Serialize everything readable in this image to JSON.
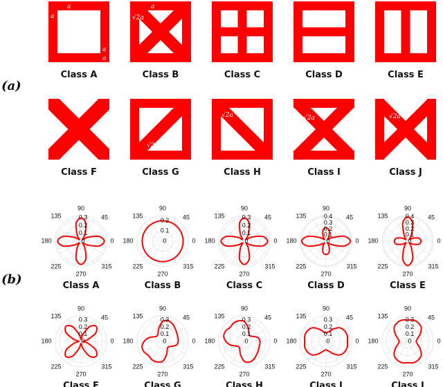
{
  "panel_labels": {
    "a": "(a)",
    "b": "(b)"
  },
  "annotation": {
    "a": "a",
    "root2a": "√2a"
  },
  "colors": {
    "structure": "#ff0000",
    "curve": "#ff0000",
    "grid": "#e0e0e0"
  },
  "classes": [
    "Class A",
    "Class B",
    "Class C",
    "Class D",
    "Class E",
    "Class F",
    "Class G",
    "Class H",
    "Class I",
    "Class J"
  ],
  "chart_data": {
    "type": "polar",
    "angle_ticks": [
      "90",
      "45",
      "0",
      "315",
      "270",
      "225",
      "180",
      "135"
    ],
    "angles_deg": [
      0,
      15,
      30,
      45,
      60,
      75,
      90,
      105,
      120,
      135,
      150,
      165,
      180,
      195,
      210,
      225,
      240,
      255,
      270,
      285,
      300,
      315,
      330,
      345
    ],
    "plots": [
      {
        "class": "Class A",
        "r_ticks": [
          "0",
          "0.1",
          "0.2",
          "0.3"
        ],
        "rmax": 0.33,
        "r": [
          0.3,
          0.24,
          0.1,
          0.03,
          0.1,
          0.24,
          0.3,
          0.24,
          0.1,
          0.03,
          0.1,
          0.24,
          0.3,
          0.24,
          0.1,
          0.03,
          0.1,
          0.24,
          0.3,
          0.24,
          0.1,
          0.03,
          0.1,
          0.24
        ]
      },
      {
        "class": "Class B",
        "r_ticks": [
          "0",
          "0.1",
          "0.2"
        ],
        "rmax": 0.25,
        "r": [
          0.2,
          0.2,
          0.2,
          0.2,
          0.2,
          0.2,
          0.2,
          0.2,
          0.2,
          0.2,
          0.2,
          0.2,
          0.2,
          0.2,
          0.2,
          0.2,
          0.2,
          0.2,
          0.2,
          0.2,
          0.2,
          0.2,
          0.2,
          0.2
        ]
      },
      {
        "class": "Class C",
        "r_ticks": [
          "0",
          "0.1",
          "0.2",
          "0.3"
        ],
        "rmax": 0.33,
        "r": [
          0.3,
          0.24,
          0.1,
          0.03,
          0.1,
          0.24,
          0.3,
          0.24,
          0.1,
          0.03,
          0.1,
          0.24,
          0.3,
          0.24,
          0.1,
          0.03,
          0.1,
          0.24,
          0.3,
          0.24,
          0.1,
          0.03,
          0.1,
          0.24
        ]
      },
      {
        "class": "Class D",
        "r_ticks": [
          "0",
          "0.1",
          "0.2",
          "0.3",
          "0.4"
        ],
        "rmax": 0.42,
        "r": [
          0.4,
          0.31,
          0.12,
          0.04,
          0.1,
          0.19,
          0.22,
          0.19,
          0.1,
          0.04,
          0.12,
          0.31,
          0.4,
          0.31,
          0.12,
          0.04,
          0.1,
          0.19,
          0.22,
          0.19,
          0.1,
          0.04,
          0.12,
          0.31
        ]
      },
      {
        "class": "Class E",
        "r_ticks": [
          "0",
          "0.1",
          "0.2",
          "0.3",
          "0.4"
        ],
        "rmax": 0.42,
        "r": [
          0.22,
          0.19,
          0.1,
          0.04,
          0.12,
          0.31,
          0.4,
          0.31,
          0.12,
          0.04,
          0.1,
          0.19,
          0.22,
          0.19,
          0.1,
          0.04,
          0.12,
          0.31,
          0.4,
          0.31,
          0.12,
          0.04,
          0.1,
          0.19
        ]
      },
      {
        "class": "Class F",
        "r_ticks": [
          "0",
          "0.1",
          "0.2",
          "0.3"
        ],
        "rmax": 0.36,
        "r": [
          0.03,
          0.1,
          0.24,
          0.3,
          0.24,
          0.1,
          0.03,
          0.1,
          0.24,
          0.3,
          0.24,
          0.1,
          0.03,
          0.1,
          0.24,
          0.3,
          0.24,
          0.1,
          0.03,
          0.1,
          0.24,
          0.3,
          0.24,
          0.1
        ]
      },
      {
        "class": "Class G",
        "r_ticks": [
          "0",
          "0.1",
          "0.2",
          "0.3"
        ],
        "rmax": 0.36,
        "r": [
          0.22,
          0.22,
          0.23,
          0.25,
          0.28,
          0.3,
          0.28,
          0.2,
          0.13,
          0.11,
          0.13,
          0.2,
          0.26,
          0.3,
          0.3,
          0.28,
          0.3,
          0.3,
          0.28,
          0.2,
          0.13,
          0.11,
          0.14,
          0.2
        ]
      },
      {
        "class": "Class H",
        "r_ticks": [
          "0",
          "0.1",
          "0.2",
          "0.3"
        ],
        "rmax": 0.36,
        "r": [
          0.22,
          0.2,
          0.14,
          0.11,
          0.13,
          0.2,
          0.28,
          0.3,
          0.3,
          0.28,
          0.3,
          0.3,
          0.26,
          0.2,
          0.13,
          0.11,
          0.13,
          0.2,
          0.28,
          0.3,
          0.28,
          0.25,
          0.23,
          0.22
        ]
      },
      {
        "class": "Class I",
        "r_ticks": [
          "0",
          "0.1",
          "0.2",
          "0.3"
        ],
        "rmax": 0.36,
        "r": [
          0.3,
          0.31,
          0.3,
          0.27,
          0.2,
          0.14,
          0.12,
          0.14,
          0.2,
          0.27,
          0.3,
          0.31,
          0.3,
          0.31,
          0.3,
          0.27,
          0.2,
          0.14,
          0.12,
          0.14,
          0.2,
          0.27,
          0.3,
          0.31
        ]
      },
      {
        "class": "Class J",
        "r_ticks": [
          "0",
          "0.1",
          "0.2",
          "0.3"
        ],
        "rmax": 0.36,
        "r": [
          0.12,
          0.14,
          0.2,
          0.27,
          0.3,
          0.31,
          0.3,
          0.31,
          0.3,
          0.27,
          0.2,
          0.14,
          0.12,
          0.14,
          0.2,
          0.27,
          0.3,
          0.31,
          0.3,
          0.31,
          0.3,
          0.27,
          0.2,
          0.14
        ]
      }
    ]
  }
}
